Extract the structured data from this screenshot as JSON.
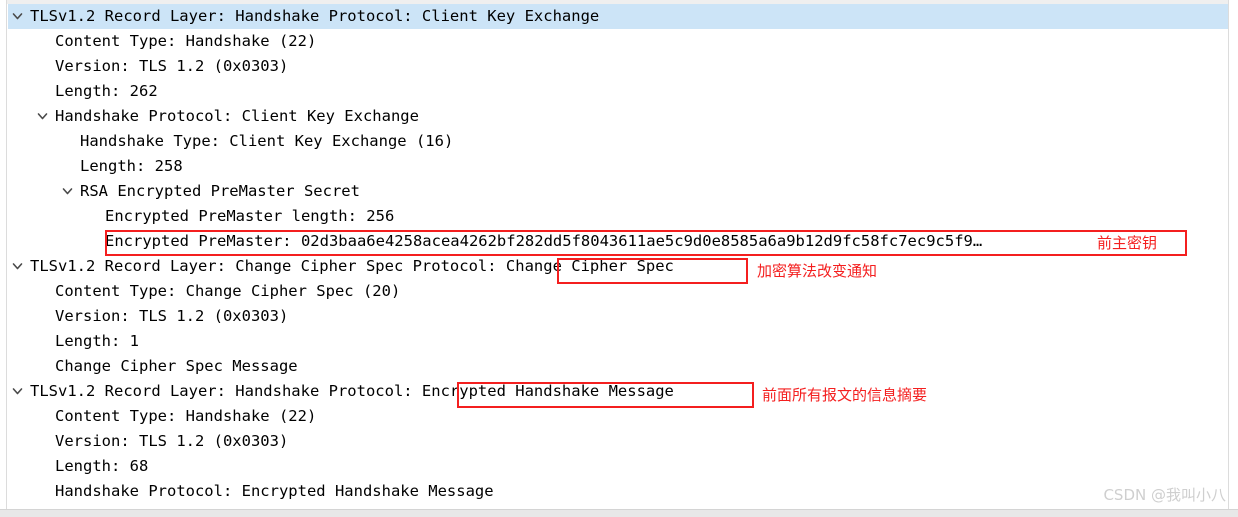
{
  "pane": {
    "title": "TLS handshake packet detail tree"
  },
  "tree": {
    "rows": [
      {
        "text": "TLSv1.2 Record Layer: Handshake Protocol: Client Key Exchange",
        "level": 0,
        "expandable": true,
        "selected": true
      },
      {
        "text": "Content Type: Handshake (22)",
        "level": 1,
        "expandable": false,
        "selected": false
      },
      {
        "text": "Version: TLS 1.2 (0x0303)",
        "level": 1,
        "expandable": false,
        "selected": false
      },
      {
        "text": "Length: 262",
        "level": 1,
        "expandable": false,
        "selected": false
      },
      {
        "text": "Handshake Protocol: Client Key Exchange",
        "level": 1,
        "expandable": true,
        "selected": false
      },
      {
        "text": "Handshake Type: Client Key Exchange (16)",
        "level": 2,
        "expandable": false,
        "selected": false
      },
      {
        "text": "Length: 258",
        "level": 2,
        "expandable": false,
        "selected": false
      },
      {
        "text": "RSA Encrypted PreMaster Secret",
        "level": 2,
        "expandable": true,
        "selected": false
      },
      {
        "text": "Encrypted PreMaster length: 256",
        "level": 3,
        "expandable": false,
        "selected": false
      },
      {
        "text": "Encrypted PreMaster: 02d3baa6e4258acea4262bf282dd5f8043611ae5c9d0e8585a6a9b12d9fc58fc7ec9c5f9…",
        "level": 3,
        "expandable": false,
        "selected": false
      },
      {
        "text": "TLSv1.2 Record Layer: Change Cipher Spec Protocol: Change Cipher Spec",
        "level": 0,
        "expandable": true,
        "selected": false
      },
      {
        "text": "Content Type: Change Cipher Spec (20)",
        "level": 1,
        "expandable": false,
        "selected": false
      },
      {
        "text": "Version: TLS 1.2 (0x0303)",
        "level": 1,
        "expandable": false,
        "selected": false
      },
      {
        "text": "Length: 1",
        "level": 1,
        "expandable": false,
        "selected": false
      },
      {
        "text": "Change Cipher Spec Message",
        "level": 1,
        "expandable": false,
        "selected": false
      },
      {
        "text": "TLSv1.2 Record Layer: Handshake Protocol: Encrypted Handshake Message",
        "level": 0,
        "expandable": true,
        "selected": false
      },
      {
        "text": "Content Type: Handshake (22)",
        "level": 1,
        "expandable": false,
        "selected": false
      },
      {
        "text": "Version: TLS 1.2 (0x0303)",
        "level": 1,
        "expandable": false,
        "selected": false
      },
      {
        "text": "Length: 68",
        "level": 1,
        "expandable": false,
        "selected": false
      },
      {
        "text": "Handshake Protocol: Encrypted Handshake Message",
        "level": 1,
        "expandable": false,
        "selected": false
      }
    ]
  },
  "annotations": {
    "premaster_note": "前主密钥",
    "change_cipher_note": "加密算法改变通知",
    "encrypted_handshake_note": "前面所有报文的信息摘要"
  },
  "colors": {
    "annotation_red": "#f41f1f",
    "selection_blue": "#cce4f7",
    "text": "#000000",
    "watermark": "#cfcfcf"
  },
  "watermark": {
    "text": "CSDN @我叫小八"
  }
}
